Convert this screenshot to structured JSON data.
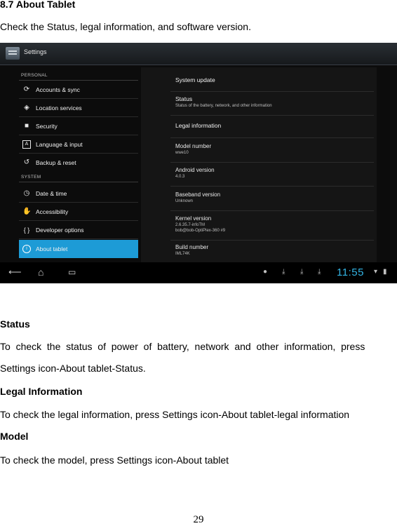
{
  "doc": {
    "section_heading": "8.7 About Tablet",
    "intro": "Check the Status, legal information, and software version.",
    "status_heading": "Status",
    "status_line1": "To  check  the  status  of  power  of  battery,  network  and  other  information,  press",
    "status_line2": "Settings icon-About tablet-Status.",
    "legal_heading": "Legal Information",
    "legal_text": "To check the legal information, press Settings icon-About tablet-legal information",
    "model_heading": "Model",
    "model_text": "To check the model, press Settings icon-About tablet",
    "page_number": "29"
  },
  "screenshot": {
    "app_title": "Settings",
    "sections": {
      "personal": "PERSONAL",
      "system": "SYSTEM"
    },
    "left_items": [
      {
        "label": "Accounts & sync",
        "icon": "sync-icon"
      },
      {
        "label": "Location services",
        "icon": "location-icon"
      },
      {
        "label": "Security",
        "icon": "lock-icon"
      },
      {
        "label": "Language & input",
        "icon": "keyboard-icon"
      },
      {
        "label": "Backup & reset",
        "icon": "backup-icon"
      },
      {
        "label": "Date & time",
        "icon": "clock-icon"
      },
      {
        "label": "Accessibility",
        "icon": "hand-icon"
      },
      {
        "label": "Developer options",
        "icon": "braces-icon"
      },
      {
        "label": "About tablet",
        "icon": "info-icon",
        "selected": true
      }
    ],
    "right_items": [
      {
        "title": "System update"
      },
      {
        "title": "Status",
        "summary": "Status of the battery, network, and other information"
      },
      {
        "title": "Legal information"
      },
      {
        "title": "Model number",
        "summary": "wwe10"
      },
      {
        "title": "Android version",
        "summary": "4.0.3"
      },
      {
        "title": "Baseband version",
        "summary": "Unknown"
      },
      {
        "title": "Kernel version",
        "summary": "2.6.35.7-infoTM",
        "summary2": "bob@bob-OptiPlex-360 #9"
      },
      {
        "title": "Build number",
        "summary": "IML74K"
      }
    ],
    "clock": "11:55",
    "accent_color": "#1d9bd6"
  }
}
